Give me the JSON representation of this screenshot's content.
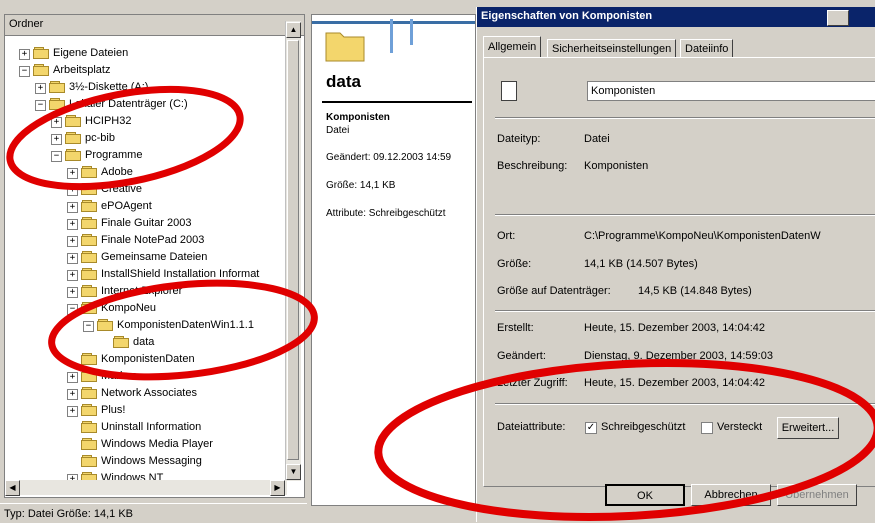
{
  "folder_pane": {
    "title": "Ordner",
    "close": "×",
    "tree": [
      {
        "label": "Eigene Dateien",
        "exp": "+",
        "icon": "my-documents-icon"
      },
      {
        "label": "Arbeitsplatz",
        "exp": "−",
        "icon": "computer-icon"
      },
      {
        "label": "3½-Diskette (A:)",
        "exp": "+",
        "icon": "floppy-icon"
      },
      {
        "label": "Lokaler Datenträger (C:)",
        "exp": "−",
        "icon": "drive-icon"
      },
      {
        "label": "HCIPH32",
        "exp": "+",
        "icon": "folder-icon"
      },
      {
        "label": "pc-bib",
        "exp": "+",
        "icon": "folder-icon"
      },
      {
        "label": "Programme",
        "exp": "−",
        "icon": "folder-icon"
      },
      {
        "label": "Adobe",
        "exp": "+",
        "icon": "folder-icon"
      },
      {
        "label": "Creative",
        "exp": "+",
        "icon": "folder-icon"
      },
      {
        "label": "ePOAgent",
        "exp": "+",
        "icon": "folder-icon"
      },
      {
        "label": "Finale Guitar 2003",
        "exp": "+",
        "icon": "folder-icon"
      },
      {
        "label": "Finale NotePad 2003",
        "exp": "+",
        "icon": "folder-icon"
      },
      {
        "label": "Gemeinsame Dateien",
        "exp": "+",
        "icon": "folder-icon"
      },
      {
        "label": "InstallShield Installation Informat",
        "exp": "+",
        "icon": "folder-icon"
      },
      {
        "label": "Internet Explorer",
        "exp": "+",
        "icon": "folder-icon"
      },
      {
        "label": "KompoNeu",
        "exp": "−",
        "icon": "folder-icon"
      },
      {
        "label": "KomponistenDatenWin1.1.1",
        "exp": "−",
        "icon": "folder-icon"
      },
      {
        "label": "data",
        "exp": "",
        "icon": "open-folder-icon"
      },
      {
        "label": "KomponistenDaten",
        "exp": "",
        "icon": "folder-icon"
      },
      {
        "label": "Markus",
        "exp": "+",
        "icon": "folder-icon"
      },
      {
        "label": "Network Associates",
        "exp": "+",
        "icon": "folder-icon"
      },
      {
        "label": "Plus!",
        "exp": "+",
        "icon": "folder-icon"
      },
      {
        "label": "Uninstall Information",
        "exp": "",
        "icon": "folder-icon"
      },
      {
        "label": "Windows Media Player",
        "exp": "",
        "icon": "folder-icon"
      },
      {
        "label": "Windows Messaging",
        "exp": "",
        "icon": "folder-icon"
      },
      {
        "label": "Windows NT",
        "exp": "+",
        "icon": "folder-icon"
      }
    ]
  },
  "status_bar": {
    "text": "Typ: Datei Größe: 14,1 KB"
  },
  "middle_pane": {
    "folder_title": "data",
    "file_name": "Komponisten",
    "file_type": "Datei",
    "modified": "Geändert: 09.12.2003 14:59",
    "size": "Größe: 14,1 KB",
    "attributes": "Attribute: Schreibgeschützt"
  },
  "dialog": {
    "title": "Eigenschaften von Komponisten",
    "tabs": [
      "Allgemein",
      "Sicherheitseinstellungen",
      "Dateiinfo"
    ],
    "name_value": "Komponisten",
    "rows": {
      "type_label": "Dateityp:",
      "type_value": "Datei",
      "desc_label": "Beschreibung:",
      "desc_value": "Komponisten",
      "location_label": "Ort:",
      "location_value": "C:\\Programme\\KompoNeu\\KomponistenDatenW",
      "size_label": "Größe:",
      "size_value": "14,1 KB (14.507 Bytes)",
      "disk_size_label": "Größe auf Datenträger:",
      "disk_size_value": "14,5 KB (14.848 Bytes)",
      "created_label": "Erstellt:",
      "created_value": "Heute, 15. Dezember 2003, 14:04:42",
      "modified_label": "Geändert:",
      "modified_value": "Dienstag, 9. Dezember 2003, 14:59:03",
      "accessed_label": "Letzter Zugriff:",
      "accessed_value": "Heute, 15. Dezember 2003, 14:04:42",
      "attributes_label": "Dateiattribute:"
    },
    "readonly_label": "Schreibgeschützt",
    "readonly_checked": "✓",
    "hidden_label": "Versteckt",
    "advanced_button": "Erweitert...",
    "ok_button": "OK",
    "cancel_button": "Abbrechen",
    "apply_button": "Übernehmen"
  },
  "annotation_color": "#e00000"
}
